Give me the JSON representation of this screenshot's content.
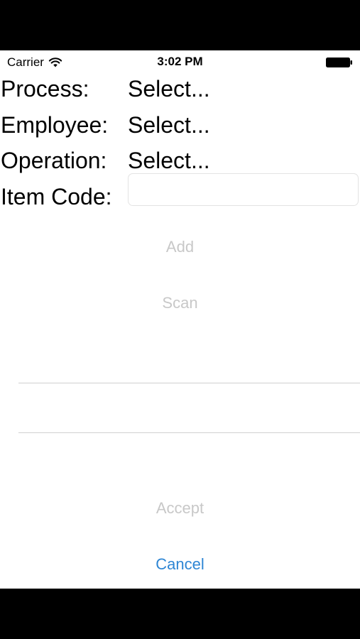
{
  "status_bar": {
    "carrier": "Carrier",
    "time": "3:02 PM"
  },
  "form": {
    "process": {
      "label": "Process:",
      "value": "Select..."
    },
    "employee": {
      "label": "Employee:",
      "value": "Select..."
    },
    "operation": {
      "label": "Operation:",
      "value": "Select..."
    },
    "item_code": {
      "label": "Item Code:",
      "value": ""
    }
  },
  "buttons": {
    "add": "Add",
    "scan": "Scan",
    "accept": "Accept",
    "cancel": "Cancel"
  },
  "colors": {
    "accent": "#2e86d4",
    "disabled": "#c8c8c8"
  }
}
